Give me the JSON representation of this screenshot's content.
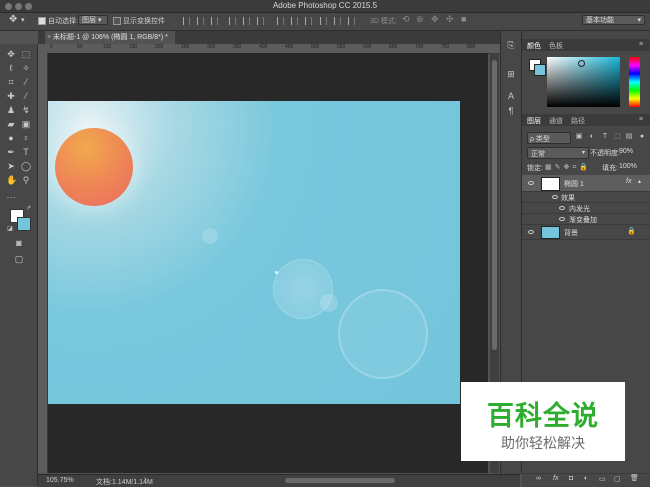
{
  "app_title": "Adobe Photoshop CC 2015.5",
  "options": {
    "auto_select_label": "自动选择:",
    "auto_select_value": "图层",
    "show_transform_label": "显示变换控件",
    "mode_3d_label": "3D 模式:",
    "workspace_value": "基本功能"
  },
  "document_tab": {
    "label": "未标题-1 @ 106% (椭圆 1, RGB/8*) *"
  },
  "status": {
    "zoom": "105.75%",
    "doc_info": "文档:1.14M/1.14M"
  },
  "color_panel": {
    "tabs": [
      "颜色",
      "色板"
    ]
  },
  "layers_panel": {
    "tabs": [
      "图层",
      "通道",
      "路径"
    ],
    "filter_label": "ρ 类型",
    "blend_mode": "正常",
    "opacity_label": "不透明度:",
    "opacity_value": "90%",
    "lock_label": "锁定:",
    "fill_label": "填充:",
    "fill_value": "100%",
    "layers": [
      {
        "name": "椭圆 1",
        "fx": "fx"
      },
      {
        "name": "背景"
      }
    ],
    "effects_label": "效果",
    "effects": [
      "内发光",
      "渐变叠加"
    ],
    "bottom_icons": [
      "∞",
      "fx",
      "◘",
      "◐",
      "▭",
      "▢",
      "🗑"
    ]
  },
  "ruler": {
    "h_ticks": [
      "0",
      "50",
      "100",
      "150",
      "200",
      "250",
      "300",
      "350",
      "400",
      "450",
      "500",
      "550",
      "600",
      "650",
      "700",
      "750",
      "800"
    ]
  },
  "watermark": {
    "title": "百科全说",
    "subtitle": "助你轻松解决"
  },
  "colors": {
    "canvas": "#74c5dc",
    "sun_top": "#f1a94d",
    "sun_bottom": "#ec6b5f",
    "watermark_green": "#2eae2e"
  }
}
